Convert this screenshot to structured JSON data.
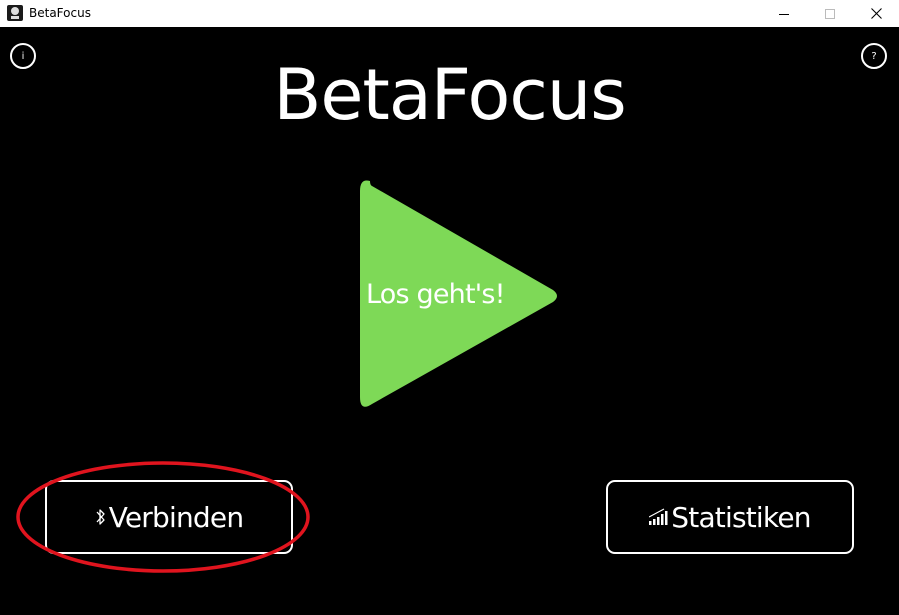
{
  "window": {
    "title": "BetaFocus",
    "icon": "app-logo-icon",
    "controls": [
      "minimize-icon",
      "maximize-icon",
      "close-icon"
    ]
  },
  "header": {
    "info_label": "i",
    "help_label": "?",
    "heading": "BetaFocus"
  },
  "play": {
    "label": "Los geht's!",
    "color": "#7ed957"
  },
  "buttons": {
    "connect": {
      "label": "Verbinden",
      "icon": "bluetooth-icon"
    },
    "statistics": {
      "label": "Statistiken",
      "icon": "signal-bars-icon"
    }
  },
  "annotation": {
    "color": "#e0141e"
  }
}
